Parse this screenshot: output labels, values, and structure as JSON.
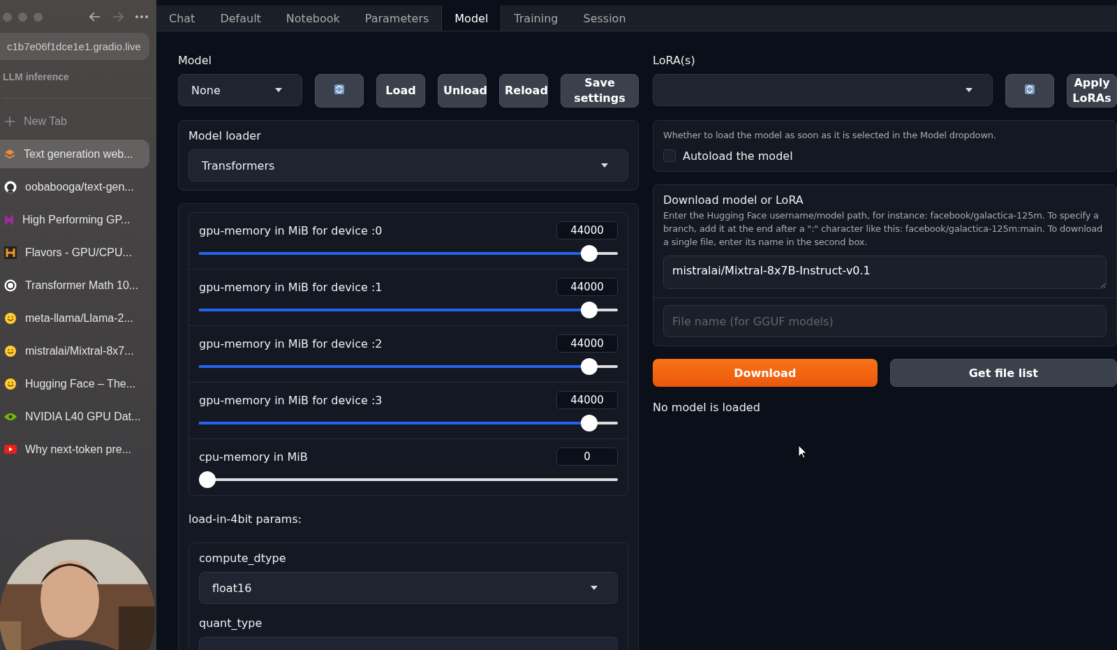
{
  "browser": {
    "address": "c1b7e06f1dce1e1.gradio.live",
    "space": "LLM inference",
    "new_tab": "New Tab",
    "tabs": [
      {
        "title": "Text generation web...",
        "selected": true
      },
      {
        "title": "oobabooga/text-gen...",
        "selected": false
      },
      {
        "title": "High Performing GP...",
        "selected": false
      },
      {
        "title": "Flavors - GPU/CPU...",
        "selected": false
      },
      {
        "title": "Transformer Math 10...",
        "selected": false
      },
      {
        "title": "meta-llama/Llama-2...",
        "selected": false
      },
      {
        "title": "mistralai/Mixtral-8x7...",
        "selected": false
      },
      {
        "title": "Hugging Face – The...",
        "selected": false
      },
      {
        "title": "NVIDIA L40 GPU Dat...",
        "selected": false
      },
      {
        "title": "Why next-token pre...",
        "selected": false
      }
    ]
  },
  "tabs": [
    {
      "label": "Chat",
      "selected": false
    },
    {
      "label": "Default",
      "selected": false
    },
    {
      "label": "Notebook",
      "selected": false
    },
    {
      "label": "Parameters",
      "selected": false
    },
    {
      "label": "Model",
      "selected": true
    },
    {
      "label": "Training",
      "selected": false
    },
    {
      "label": "Session",
      "selected": false
    }
  ],
  "model": {
    "label": "Model",
    "value": "None",
    "buttons": [
      "Load",
      "Unload",
      "Reload",
      "Save settings"
    ]
  },
  "lora": {
    "label": "LoRA(s)",
    "button": "Apply LoRAs"
  },
  "model_loader": {
    "label": "Model loader",
    "value": "Transformers"
  },
  "sliders": [
    {
      "label": "gpu-memory in MiB for device :0",
      "value": "44000",
      "level": 0.95
    },
    {
      "label": "gpu-memory in MiB for device :1",
      "value": "44000",
      "level": 0.95
    },
    {
      "label": "gpu-memory in MiB for device :2",
      "value": "44000",
      "level": 0.95
    },
    {
      "label": "gpu-memory in MiB for device :3",
      "value": "44000",
      "level": 0.95
    },
    {
      "label": "cpu-memory in MiB",
      "value": "0",
      "level": 0
    }
  ],
  "params_heading": "load-in-4bit params:",
  "compute_dtype": {
    "label": "compute_dtype",
    "value": "float16"
  },
  "quant_type": {
    "label": "quant_type"
  },
  "autoload": {
    "info": "Whether to load the model as soon as it is selected in the Model dropdown.",
    "label": "Autoload the model",
    "checked": false
  },
  "download": {
    "title": "Download model or LoRA",
    "info": "Enter the Hugging Face username/model path, for instance: facebook/galactica-125m. To specify a branch, add it at the end after a \":\" character like this: facebook/galactica-125m:main. To download a single file, enter its name in the second box.",
    "value": "mistralai/Mixtral-8x7B-Instruct-v0.1",
    "file_placeholder": "File name (for GGUF models)",
    "download_button": "Download",
    "list_button": "Get file list"
  },
  "status": "No model is loaded"
}
